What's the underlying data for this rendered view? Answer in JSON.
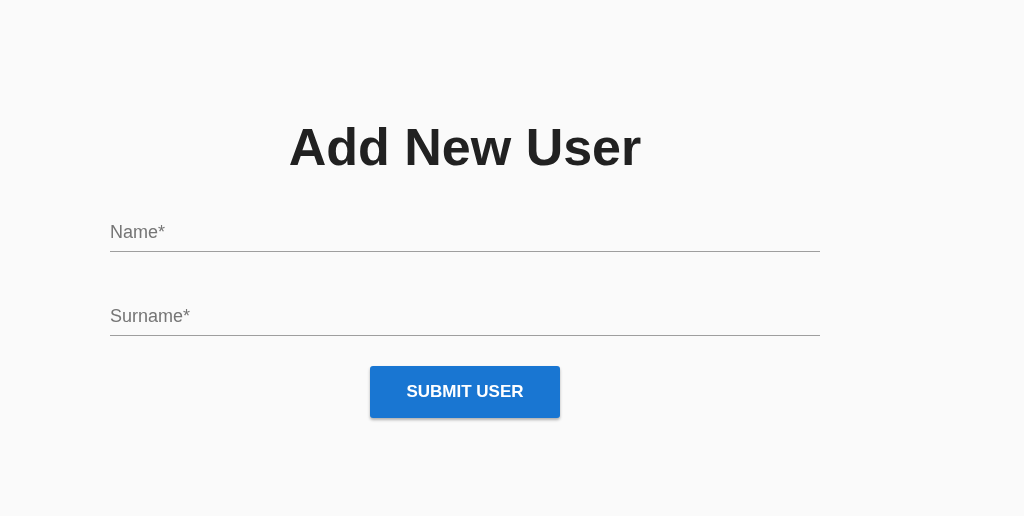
{
  "title": "Add New User",
  "fields": [
    {
      "placeholder": "Name*"
    },
    {
      "placeholder": "Surname*"
    }
  ],
  "submit_button": "SUBMIT USER"
}
